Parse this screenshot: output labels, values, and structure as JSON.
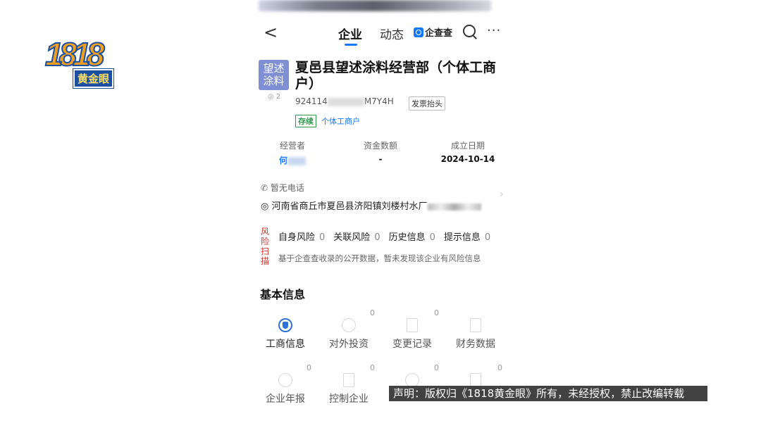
{
  "logo": {
    "digits": "1818",
    "tag": "黄金眼"
  },
  "nav": {
    "back_glyph": "<",
    "tabs": [
      {
        "label": "企业"
      },
      {
        "label": "动态"
      }
    ],
    "brand": "企查查",
    "more_glyph": "···"
  },
  "company": {
    "avatar_line1": "望述",
    "avatar_line2": "涂料",
    "views": "2",
    "name": "夏邑县望述涂料经营部（个体工商户）",
    "credit_prefix": "924114",
    "credit_suffix": "M7Y4H",
    "invoice_label": "发票抬头",
    "status_tag": "存续",
    "type_tag": "个体工商户"
  },
  "key_values": [
    {
      "label": "经营者",
      "value": "何"
    },
    {
      "label": "资金数额",
      "value": "-"
    },
    {
      "label": "成立日期",
      "value": "2024-10-14"
    }
  ],
  "contact": {
    "phone": "暂无电话",
    "address": "河南省商丘市夏邑县济阳镇刘楼村水厂"
  },
  "risk": {
    "vertical_label": [
      "风",
      "险",
      "扫",
      "描"
    ],
    "items": [
      {
        "label": "自身风险",
        "count": "0"
      },
      {
        "label": "关联风险",
        "count": "0"
      },
      {
        "label": "历史信息",
        "count": "0"
      },
      {
        "label": "提示信息",
        "count": "0"
      }
    ],
    "note": "基于企查查收录的公开数据，暂未发现该企业有风险信息"
  },
  "basic_info": {
    "title": "基本信息",
    "row1": [
      {
        "label": "工商信息",
        "count": "",
        "icon": "shield-icon",
        "active": true
      },
      {
        "label": "对外投资",
        "count": "0",
        "icon": "investment-icon",
        "active": false
      },
      {
        "label": "变更记录",
        "count": "0",
        "icon": "change-record-icon",
        "active": false
      },
      {
        "label": "财务数据",
        "count": "",
        "icon": "finance-icon",
        "active": false
      }
    ],
    "row2": [
      {
        "label": "企业年报",
        "count": "0",
        "icon": "annual-report-icon"
      },
      {
        "label": "控制企业",
        "count": "0",
        "icon": "building-icon"
      },
      {
        "label": "",
        "count": "0",
        "icon": "holding-icon"
      },
      {
        "label": "",
        "count": "0",
        "icon": "news-icon"
      }
    ]
  },
  "watermark": "声明：版权归《1818黄金眼》所有，未经授权，禁止改编转载"
}
